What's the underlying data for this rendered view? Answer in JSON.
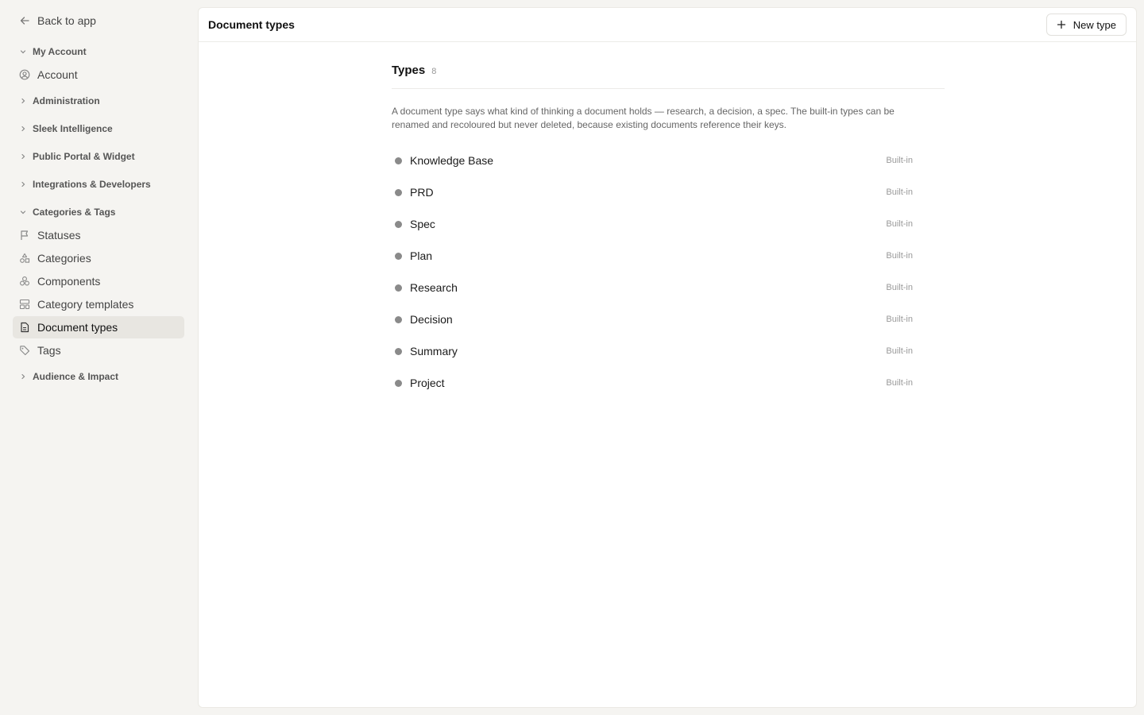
{
  "sidebar": {
    "back_label": "Back to app",
    "sections": {
      "my_account": "My Account",
      "administration": "Administration",
      "sleek_intelligence": "Sleek Intelligence",
      "public_portal": "Public Portal & Widget",
      "integrations": "Integrations & Developers",
      "categories_tags": "Categories & Tags",
      "audience_impact": "Audience & Impact"
    },
    "items": {
      "account": "Account",
      "statuses": "Statuses",
      "categories": "Categories",
      "components": "Components",
      "category_templates": "Category templates",
      "document_types": "Document types",
      "tags": "Tags"
    }
  },
  "header": {
    "title": "Document types",
    "new_button_label": "New type"
  },
  "types_section": {
    "title": "Types",
    "count": "8",
    "description": "A document type says what kind of thinking a document holds — research, a decision, a spec. The built-in types can be renamed and recoloured but never deleted, because existing documents reference their keys."
  },
  "types": [
    {
      "name": "Knowledge Base",
      "badge": "Built-in"
    },
    {
      "name": "PRD",
      "badge": "Built-in"
    },
    {
      "name": "Spec",
      "badge": "Built-in"
    },
    {
      "name": "Plan",
      "badge": "Built-in"
    },
    {
      "name": "Research",
      "badge": "Built-in"
    },
    {
      "name": "Decision",
      "badge": "Built-in"
    },
    {
      "name": "Summary",
      "badge": "Built-in"
    },
    {
      "name": "Project",
      "badge": "Built-in"
    }
  ],
  "colors": {
    "dot": "#8a8a8a",
    "active_nav_bg": "#e8e6e1",
    "sidebar_bg": "#f5f4f1"
  }
}
